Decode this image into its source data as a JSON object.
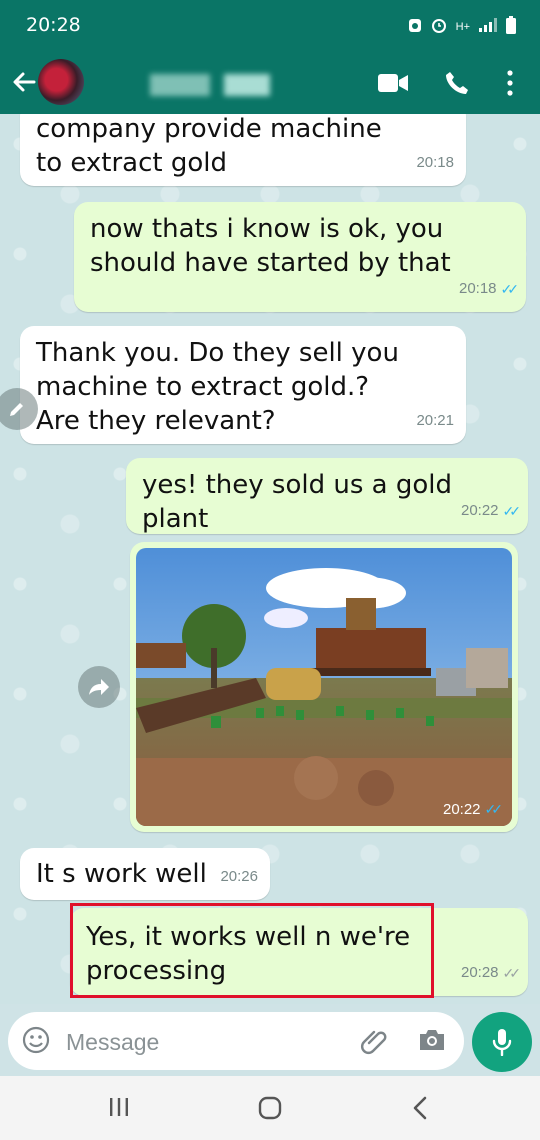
{
  "status_bar": {
    "time": "20:28",
    "network": "H+"
  },
  "chat_header": {
    "back_icon": "arrow-left-icon",
    "video_icon": "video-call-icon",
    "call_icon": "phone-icon",
    "menu_icon": "more-vert-icon"
  },
  "messages": [
    {
      "direction": "in",
      "text": "company provide machine to extract gold",
      "time": "20:18"
    },
    {
      "direction": "out",
      "text": "now thats i know is ok, you should have started by that",
      "time": "20:18",
      "read": true
    },
    {
      "direction": "in",
      "text": "Thank you. Do they sell you machine to extract gold.? Are they relevant?",
      "time": "20:21"
    },
    {
      "direction": "out",
      "text": "yes! they sold us a gold plant",
      "time": "20:22",
      "read": true
    },
    {
      "direction": "out",
      "type": "image",
      "time": "20:22",
      "read": true
    },
    {
      "direction": "in",
      "text": "It s work well",
      "time": "20:26"
    },
    {
      "direction": "out",
      "text": "Yes, it works well n we're processing",
      "time": "20:28",
      "read": false
    }
  ],
  "composer": {
    "placeholder": "Message"
  },
  "colors": {
    "header": "#0a7566",
    "outgoing": "#e7fdd3",
    "incoming": "#ffffff",
    "mic": "#12a37f",
    "highlight": "#e0102b"
  }
}
